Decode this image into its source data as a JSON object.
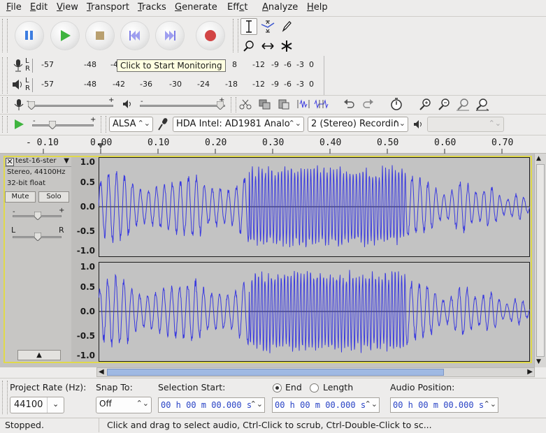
{
  "menu": [
    {
      "label": "File",
      "mn": "F",
      "rest": "ile"
    },
    {
      "label": "Edit",
      "mn": "E",
      "rest": "dit"
    },
    {
      "label": "View",
      "mn": "V",
      "rest": "iew"
    },
    {
      "label": "Transport",
      "mn": "T",
      "rest": "ransport"
    },
    {
      "label": "Tracks",
      "mn": "T",
      "rest": "racks"
    },
    {
      "label": "Generate",
      "mn": "G",
      "rest": "enerate"
    },
    {
      "label": "Effect",
      "mn": "c",
      "pre": "Eff",
      "rest": "t"
    },
    {
      "label": "Analyze",
      "mn": "A",
      "rest": "nalyze"
    },
    {
      "label": "Help",
      "mn": "H",
      "rest": "elp"
    }
  ],
  "meters": {
    "record_scale": [
      "-57",
      "-48",
      "-4",
      "8",
      "-12",
      "-9",
      "-6",
      "-3",
      "0"
    ],
    "play_scale": [
      "-57",
      "-48",
      "-42",
      "-36",
      "-30",
      "-24",
      "-18",
      "-12",
      "-9",
      "-6",
      "-3",
      "0"
    ],
    "channel_l": "L",
    "channel_r": "R",
    "tooltip": "Click to Start Monitoring"
  },
  "device": {
    "host": "ALSA",
    "recording_device": "HDA Intel: AD1981 Analo",
    "channels": "2 (Stereo) Recordin",
    "playback_device": ""
  },
  "ruler": [
    "- 0.10",
    "0.00",
    "0.10",
    "0.20",
    "0.30",
    "0.40",
    "0.50",
    "0.60",
    "0.70"
  ],
  "track": {
    "name": "test-16-ster",
    "format": "Stereo, 44100Hz",
    "bits": "32-bit float",
    "mute": "Mute",
    "solo": "Solo",
    "pan_l": "L",
    "pan_r": "R",
    "gain_minus": "-",
    "gain_plus": "+",
    "y_labels": [
      "1.0",
      "0.5",
      "0.0",
      "-0.5",
      "-1.0"
    ]
  },
  "selection": {
    "project_rate_label": "Project Rate (Hz):",
    "project_rate": "44100",
    "snap_to_label": "Snap To:",
    "snap_to": "Off",
    "selection_start_label": "Selection Start:",
    "end_label": "End",
    "length_label": "Length",
    "audio_position_label": "Audio Position:",
    "selection_start": "00 h 00 m 00.000 s",
    "selection_end": "00 h 00 m 00.000 s",
    "audio_position": "00 h 00 m 00.000 s"
  },
  "status": {
    "state": "Stopped.",
    "hint": "Click and drag to select audio, Ctrl-Click to scrub, Ctrl-Double-Click to sc..."
  },
  "colors": {
    "waveform": "#3a3adf",
    "track_border": "#e0d94b",
    "time_text": "#2a44c6"
  }
}
